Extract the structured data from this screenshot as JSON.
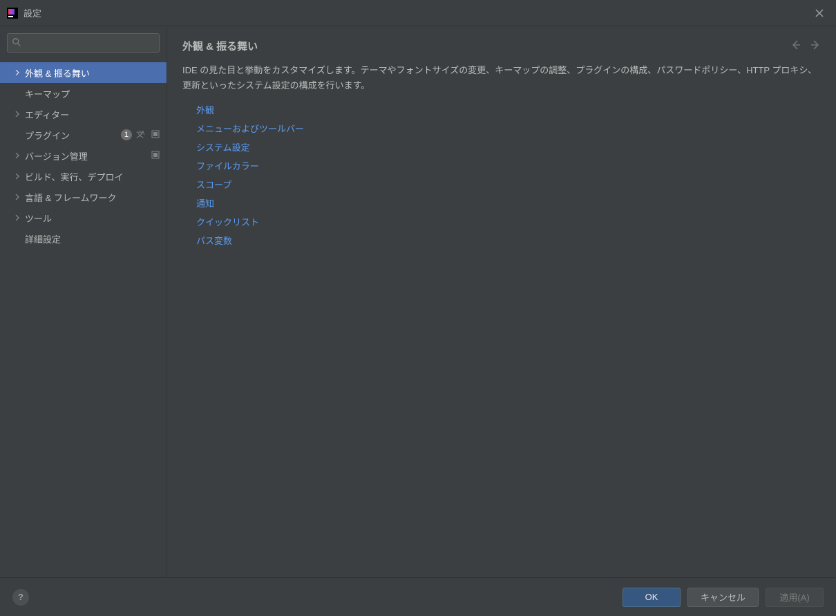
{
  "titlebar": {
    "title": "設定"
  },
  "search": {
    "value": "",
    "placeholder": ""
  },
  "sidebar": {
    "items": [
      {
        "label": "外観 & 振る舞い",
        "expandable": true,
        "selected": true
      },
      {
        "label": "キーマップ",
        "expandable": false
      },
      {
        "label": "エディター",
        "expandable": true
      },
      {
        "label": "プラグイン",
        "expandable": false,
        "badge": "1",
        "langIcon": true,
        "screenIcon": true
      },
      {
        "label": "バージョン管理",
        "expandable": true,
        "screenIcon": true
      },
      {
        "label": "ビルド、実行、デプロイ",
        "expandable": true
      },
      {
        "label": "言語 & フレームワーク",
        "expandable": true
      },
      {
        "label": "ツール",
        "expandable": true
      },
      {
        "label": "詳細設定",
        "expandable": false
      }
    ]
  },
  "content": {
    "heading": "外観 & 振る舞い",
    "description": "IDE の見た目と挙動をカスタマイズします。テーマやフォントサイズの変更、キーマップの調整、プラグインの構成、パスワードポリシー、HTTP プロキシ、更新といったシステム設定の構成を行います。",
    "links": [
      "外観",
      "メニューおよびツールバー",
      "システム設定",
      "ファイルカラー",
      "スコープ",
      "通知",
      "クイックリスト",
      "パス変数"
    ]
  },
  "footer": {
    "help": "?",
    "ok": "OK",
    "cancel": "キャンセル",
    "apply": "適用(A)"
  }
}
